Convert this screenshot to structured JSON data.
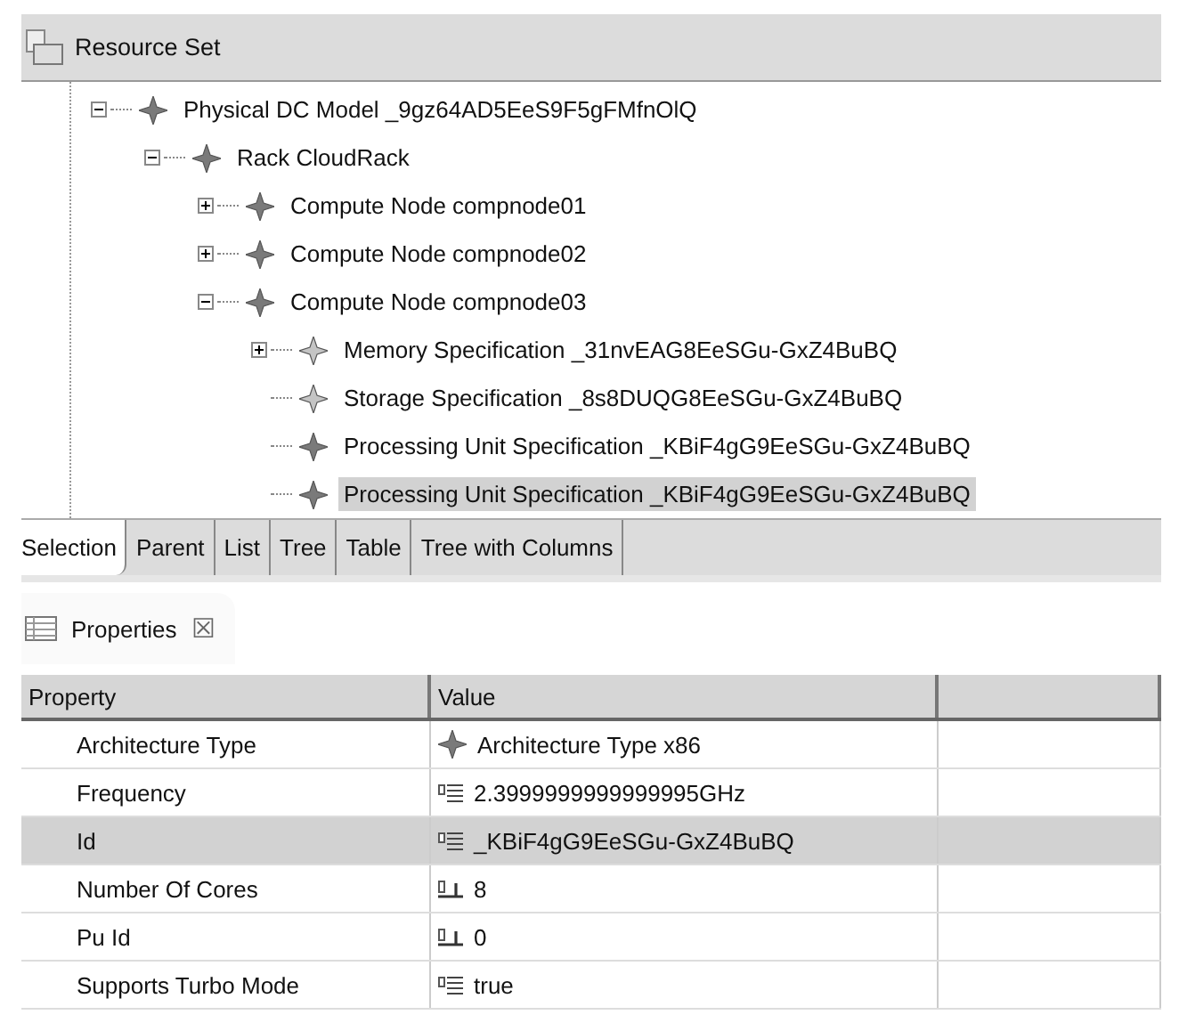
{
  "resource_view": {
    "title": "Resource Set",
    "tree": [
      {
        "label": "Physical DC Model _9gz64AD5EeS9F5gFMfnOlQ",
        "kind": "element",
        "expanded": true,
        "selected": false,
        "children": [
          {
            "label": "Rack CloudRack",
            "kind": "element",
            "expanded": true,
            "selected": false,
            "children": [
              {
                "label": "Compute Node compnode01",
                "kind": "element",
                "expanded": false,
                "selected": false
              },
              {
                "label": "Compute Node compnode02",
                "kind": "element",
                "expanded": false,
                "selected": false
              },
              {
                "label": "Compute Node compnode03",
                "kind": "element",
                "expanded": true,
                "selected": false,
                "children": [
                  {
                    "label": "Memory Specification _31nvEAG8EeSGu-GxZ4BuBQ",
                    "kind": "spec",
                    "expanded": false,
                    "selected": false
                  },
                  {
                    "label": "Storage Specification _8s8DUQG8EeSGu-GxZ4BuBQ",
                    "kind": "spec",
                    "selected": false
                  },
                  {
                    "label": "Processing Unit Specification _KBiF4gG9EeSGu-GxZ4BuBQ",
                    "kind": "element",
                    "selected": false
                  },
                  {
                    "label": "Processing Unit Specification _KBiF4gG9EeSGu-GxZ4BuBQ",
                    "kind": "element",
                    "selected": true
                  }
                ]
              }
            ]
          }
        ]
      }
    ]
  },
  "tabs": [
    {
      "label": "Selection",
      "selected": true
    },
    {
      "label": "Parent",
      "selected": false
    },
    {
      "label": "List",
      "selected": false
    },
    {
      "label": "Tree",
      "selected": false
    },
    {
      "label": "Table",
      "selected": false
    },
    {
      "label": "Tree with Columns",
      "selected": false
    }
  ],
  "properties_view": {
    "title": "Properties",
    "close": "☒",
    "columns": [
      "Property",
      "Value"
    ],
    "rows": [
      {
        "property": "Architecture Type",
        "value": "Architecture Type x86",
        "kind": "element",
        "selected": false
      },
      {
        "property": "Frequency",
        "value": "2.3999999999999995GHz",
        "kind": "text",
        "selected": false
      },
      {
        "property": "Id",
        "value": "_KBiF4gG9EeSGu-GxZ4BuBQ",
        "kind": "text",
        "selected": true
      },
      {
        "property": "Number Of Cores",
        "value": "8",
        "kind": "number",
        "selected": false
      },
      {
        "property": "Pu Id",
        "value": "0",
        "kind": "number",
        "selected": false
      },
      {
        "property": "Supports Turbo Mode",
        "value": "true",
        "kind": "text",
        "selected": false
      }
    ]
  }
}
